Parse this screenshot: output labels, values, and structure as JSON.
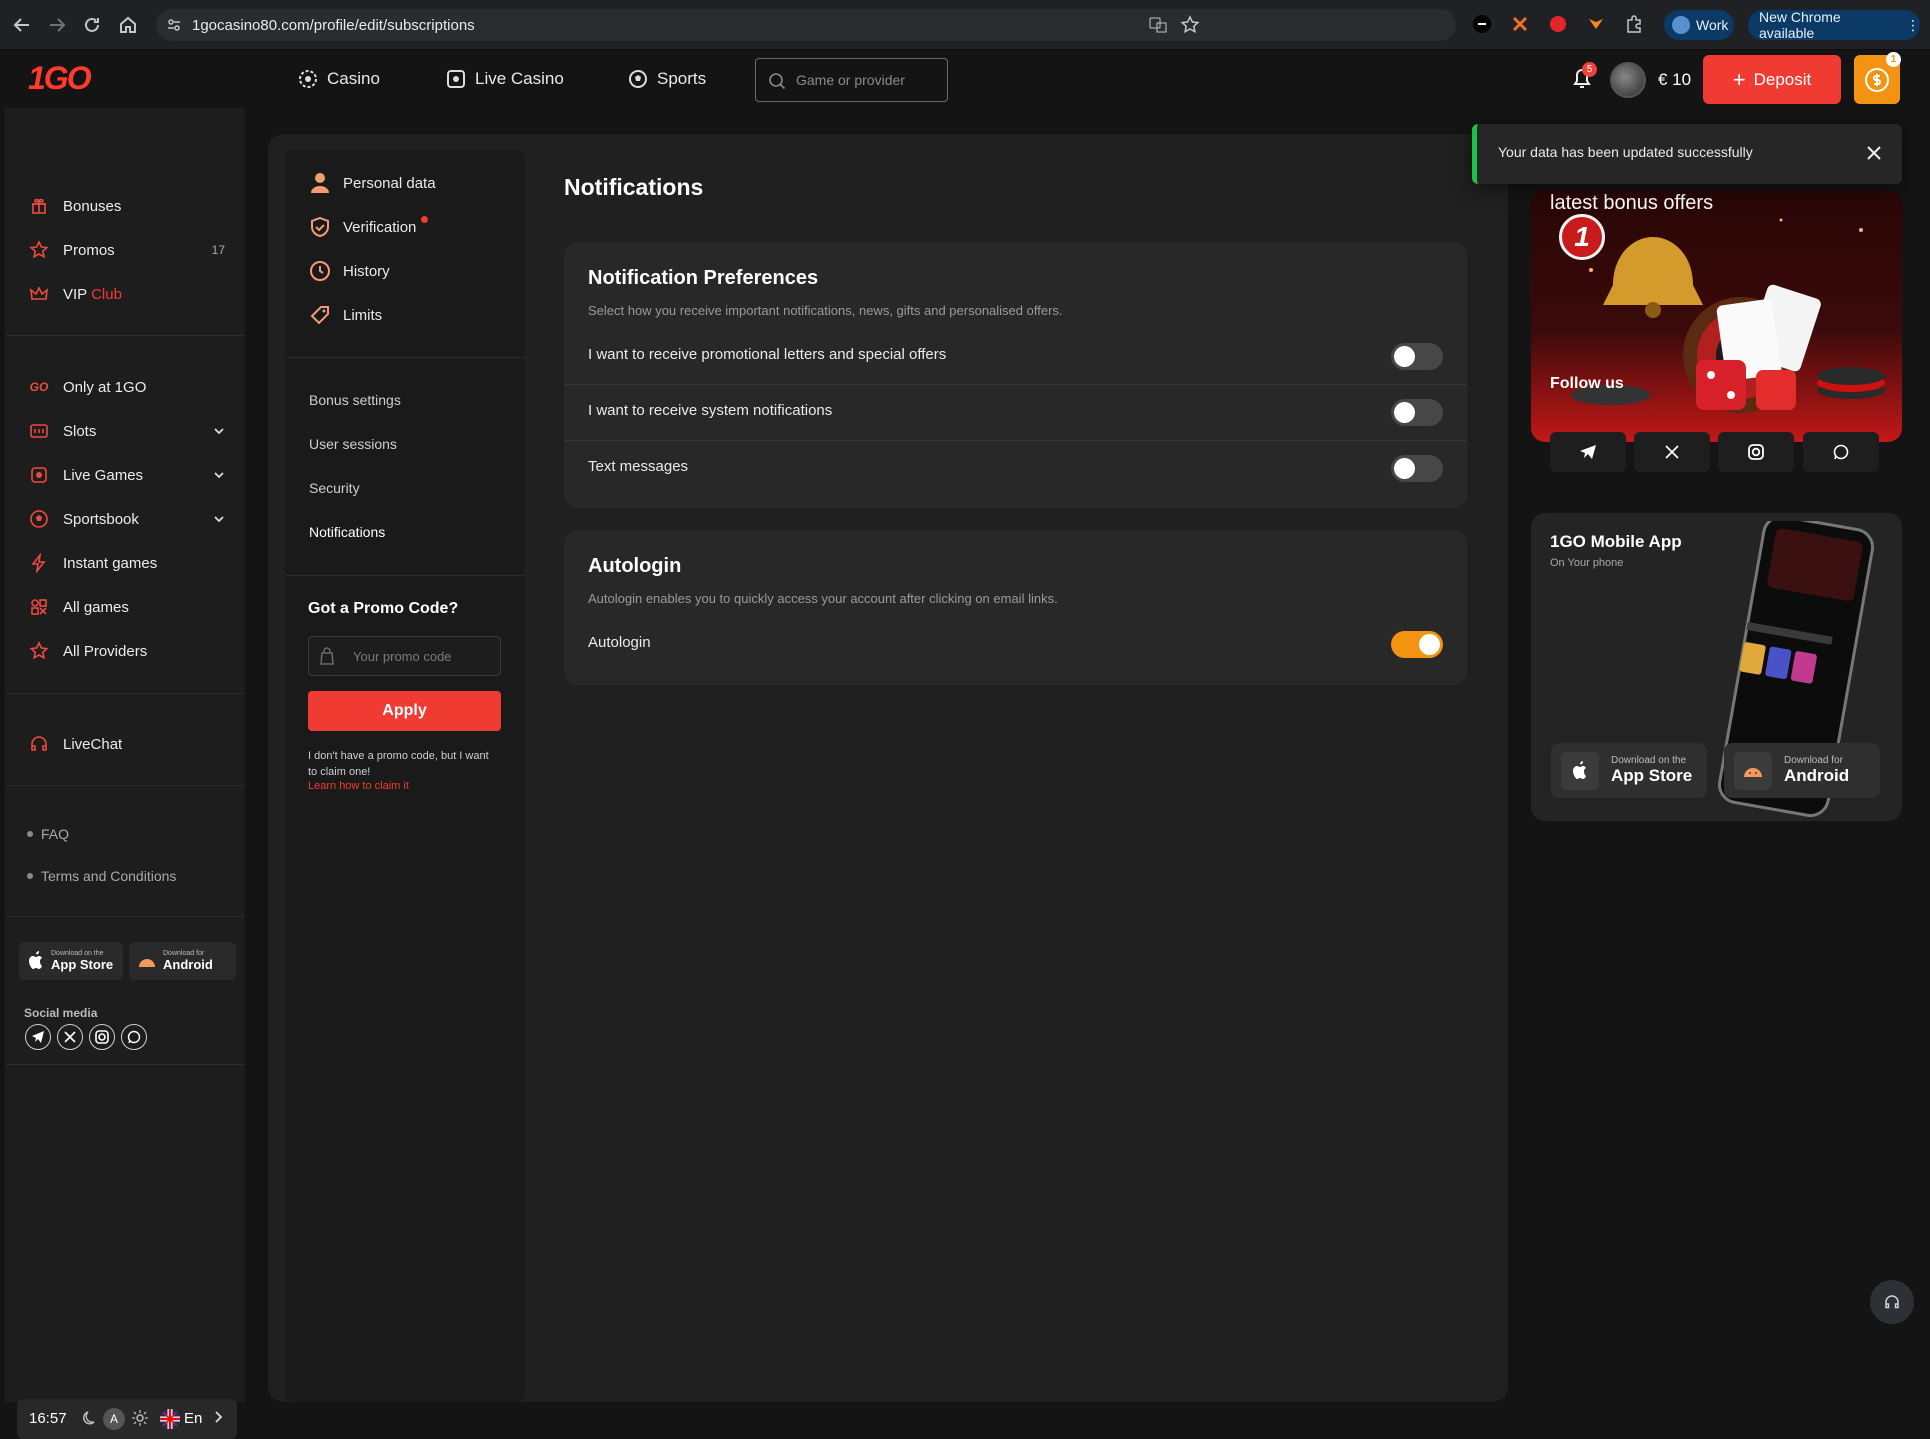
{
  "browser": {
    "url": "1gocasino80.com/profile/edit/subscriptions",
    "profile_label": "Work",
    "update_label": "New Chrome available"
  },
  "header": {
    "logo": "1GO",
    "nav": [
      {
        "label": "Casino",
        "icon": "casino-chip-icon"
      },
      {
        "label": "Live Casino",
        "icon": "live-casino-icon"
      },
      {
        "label": "Sports",
        "icon": "soccer-ball-icon"
      }
    ],
    "search_placeholder": "Game or provider",
    "notifications_count": "5",
    "balance": "€ 10",
    "deposit_label": "Deposit",
    "cashback_count": "1"
  },
  "sidebar": {
    "group1": [
      {
        "label": "Bonuses",
        "icon": "gift-icon"
      },
      {
        "label": "Promos",
        "icon": "star-icon",
        "count": "17"
      },
      {
        "label": "VIP",
        "suffix": "Club",
        "icon": "crown-icon"
      }
    ],
    "group2": [
      {
        "label": "Only at 1GO",
        "icon": "1go-icon"
      },
      {
        "label": "Slots",
        "icon": "slots-icon",
        "expandable": true
      },
      {
        "label": "Live Games",
        "icon": "live-games-icon",
        "expandable": true
      },
      {
        "label": "Sportsbook",
        "icon": "sportsbook-icon",
        "expandable": true
      },
      {
        "label": "Instant games",
        "icon": "lightning-icon"
      },
      {
        "label": "All games",
        "icon": "grid-icon"
      },
      {
        "label": "All Providers",
        "icon": "star-icon"
      }
    ],
    "livechat": "LiveChat",
    "links": [
      "FAQ",
      "Terms and Conditions"
    ],
    "stores": [
      {
        "small": "Download on the",
        "big": "App Store"
      },
      {
        "small": "Download for",
        "big": "Android"
      }
    ],
    "social_title": "Social media",
    "time": "16:57",
    "theme_auto": "A",
    "language": "En"
  },
  "profile_nav": {
    "items": [
      {
        "label": "Personal data",
        "icon": "user-icon"
      },
      {
        "label": "Verification",
        "icon": "shield-icon",
        "alert": true
      },
      {
        "label": "History",
        "icon": "clock-icon"
      },
      {
        "label": "Limits",
        "icon": "tag-icon"
      }
    ],
    "items2": [
      "Bonus settings",
      "User sessions",
      "Security",
      "Notifications"
    ],
    "promo_title": "Got a Promo Code?",
    "promo_placeholder": "Your promo code",
    "apply_label": "Apply",
    "promo_note": "I don't have a promo code, but I want to claim one!",
    "promo_link": "Learn how to claim it"
  },
  "content": {
    "page_title": "Notifications",
    "preferences": {
      "title": "Notification Preferences",
      "description": "Select how you receive important notifications, news, gifts and personalised offers.",
      "options": [
        {
          "label": "I want to receive promotional letters and special offers",
          "enabled": false
        },
        {
          "label": "I want to receive system notifications",
          "enabled": false
        },
        {
          "label": "Text messages",
          "enabled": false
        }
      ]
    },
    "autologin": {
      "title": "Autologin",
      "description": "Autologin enables you to quickly access your account after clicking on email links.",
      "option_label": "Autologin",
      "enabled": true
    }
  },
  "right_panel": {
    "toast": "Your data has been updated successfully",
    "promo_card_title": "latest bonus offers",
    "promo_badge": "1",
    "follow_us": "Follow us",
    "app": {
      "title": "1GO Mobile App",
      "subtitle": "On Your phone",
      "stores": [
        {
          "small": "Download on the",
          "big": "App Store"
        },
        {
          "small": "Download for",
          "big": "Android"
        }
      ]
    }
  },
  "colors": {
    "accent_red": "#f03b33",
    "accent_orange": "#f29312",
    "success_green": "#1fbf4a",
    "background": "#141414"
  }
}
